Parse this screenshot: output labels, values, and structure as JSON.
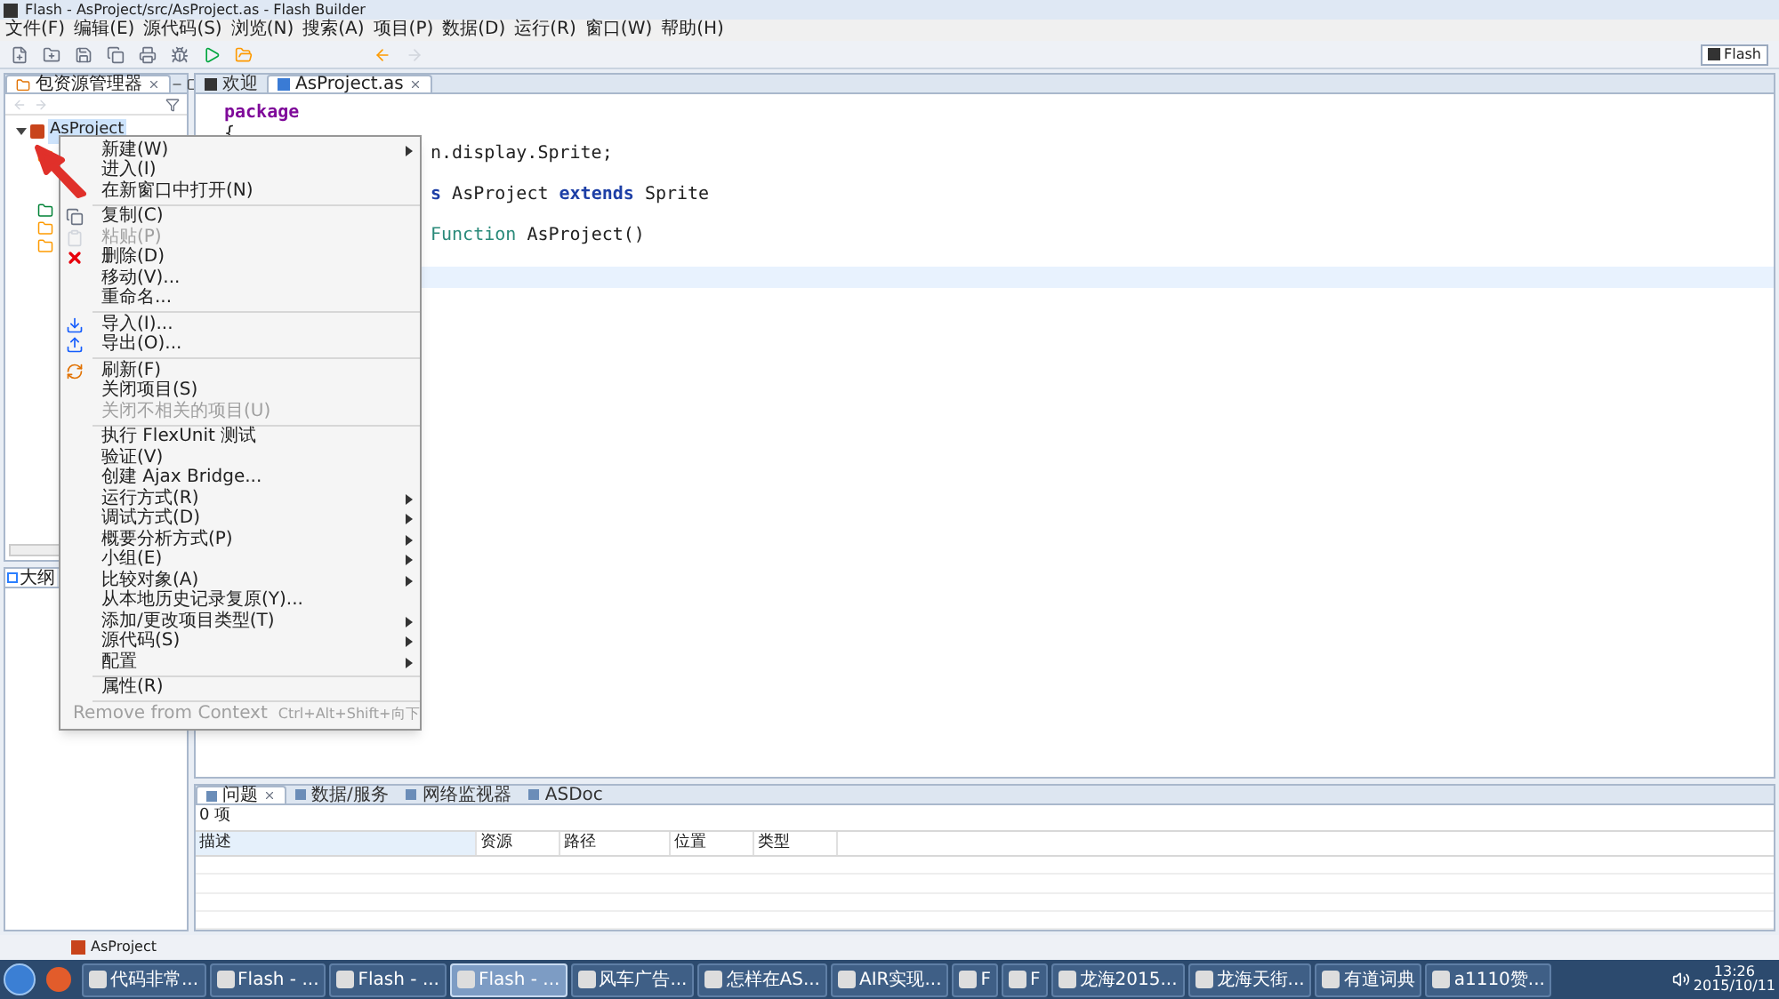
{
  "window": {
    "title": "Flash - AsProject/src/AsProject.as - Flash Builder"
  },
  "menu_bar": [
    "文件(F)",
    "编辑(E)",
    "源代码(S)",
    "浏览(N)",
    "搜索(A)",
    "项目(P)",
    "数据(D)",
    "运行(R)",
    "窗口(W)",
    "帮助(H)"
  ],
  "perspective": {
    "label": "Flash",
    "selected": true
  },
  "package_explorer": {
    "tab": "包资源管理器",
    "tree": [
      {
        "label": "AsProject",
        "selected": true,
        "expanded": true
      }
    ]
  },
  "outline": {
    "tab": "大纲"
  },
  "editor": {
    "tabs": [
      {
        "label": "欢迎",
        "selected": false
      },
      {
        "label": "AsProject.as",
        "selected": true
      }
    ],
    "lines": [
      {
        "kind": "full",
        "tokens": [
          {
            "text": "package",
            "kind": "keyword"
          }
        ]
      },
      {
        "kind": "full",
        "tokens": [
          {
            "text": "{",
            "kind": "plain"
          }
        ]
      },
      {
        "kind": "partial",
        "tokens": [
          {
            "text": "n.display.Sprite;",
            "kind": "plain"
          }
        ]
      },
      {
        "kind": "blank"
      },
      {
        "kind": "partial",
        "tokens": [
          {
            "text": "s",
            "kind": "declaration"
          },
          {
            "text": " AsProject ",
            "kind": "plain"
          },
          {
            "text": "extends",
            "kind": "declaration"
          },
          {
            "text": " Sprite",
            "kind": "plain"
          }
        ]
      },
      {
        "kind": "blank"
      },
      {
        "kind": "partial",
        "tokens": [
          {
            "text": "Function",
            "kind": "function"
          },
          {
            "text": " AsProject()",
            "kind": "plain"
          }
        ]
      },
      {
        "kind": "blank"
      },
      {
        "kind": "current"
      }
    ]
  },
  "context_menu": [
    {
      "kind": "item",
      "label": "新建(W)",
      "submenu": true,
      "disabled": false
    },
    {
      "kind": "item",
      "label": "进入(I)",
      "submenu": false,
      "disabled": false
    },
    {
      "kind": "item",
      "label": "在新窗口中打开(N)",
      "submenu": false,
      "disabled": false
    },
    {
      "kind": "separator"
    },
    {
      "kind": "item",
      "label": "复制(C)",
      "submenu": false,
      "disabled": false
    },
    {
      "kind": "item",
      "label": "粘贴(P)",
      "submenu": false,
      "disabled": true
    },
    {
      "kind": "item",
      "label": "删除(D)",
      "submenu": false,
      "disabled": false
    },
    {
      "kind": "item",
      "label": "移动(V)...",
      "submenu": false,
      "disabled": false
    },
    {
      "kind": "item",
      "label": "重命名...",
      "submenu": false,
      "disabled": false
    },
    {
      "kind": "separator"
    },
    {
      "kind": "item",
      "label": "导入(I)...",
      "submenu": false,
      "disabled": false
    },
    {
      "kind": "item",
      "label": "导出(O)...",
      "submenu": false,
      "disabled": false
    },
    {
      "kind": "separator"
    },
    {
      "kind": "item",
      "label": "刷新(F)",
      "submenu": false,
      "disabled": false
    },
    {
      "kind": "item",
      "label": "关闭项目(S)",
      "submenu": false,
      "disabled": false
    },
    {
      "kind": "item",
      "label": "关闭不相关的项目(U)",
      "submenu": false,
      "disabled": true
    },
    {
      "kind": "separator"
    },
    {
      "kind": "item",
      "label": "执行 FlexUnit 测试",
      "submenu": false,
      "disabled": false
    },
    {
      "kind": "item",
      "label": "验证(V)",
      "submenu": false,
      "disabled": false
    },
    {
      "kind": "item",
      "label": "创建 Ajax Bridge...",
      "submenu": false,
      "disabled": false
    },
    {
      "kind": "item",
      "label": "运行方式(R)",
      "submenu": true,
      "disabled": false
    },
    {
      "kind": "item",
      "label": "调试方式(D)",
      "submenu": true,
      "disabled": false
    },
    {
      "kind": "item",
      "label": "概要分析方式(P)",
      "submenu": true,
      "disabled": false
    },
    {
      "kind": "item",
      "label": "小组(E)",
      "submenu": true,
      "disabled": false
    },
    {
      "kind": "item",
      "label": "比较对象(A)",
      "submenu": true,
      "disabled": false
    },
    {
      "kind": "item",
      "label": "从本地历史记录复原(Y)...",
      "submenu": false,
      "disabled": false
    },
    {
      "kind": "item",
      "label": "添加/更改项目类型(T)",
      "submenu": true,
      "disabled": false
    },
    {
      "kind": "item",
      "label": "源代码(S)",
      "submenu": true,
      "disabled": false
    },
    {
      "kind": "item",
      "label": "配置",
      "submenu": true,
      "disabled": false
    },
    {
      "kind": "separator"
    },
    {
      "kind": "item",
      "label": "属性(R)",
      "submenu": false,
      "disabled": false
    },
    {
      "kind": "separator"
    },
    {
      "kind": "item",
      "label": "Remove from Context",
      "shortcut": "Ctrl+Alt+Shift+向下",
      "submenu": false,
      "disabled": true
    }
  ],
  "bottom_panel": {
    "tabs": [
      {
        "label": "问题",
        "selected": true
      },
      {
        "label": "数据/服务",
        "selected": false
      },
      {
        "label": "网络监视器",
        "selected": false
      },
      {
        "label": "ASDoc",
        "selected": false
      }
    ],
    "summary": "0 项",
    "columns": [
      "描述",
      "资源",
      "路径",
      "位置",
      "类型"
    ]
  },
  "status_bar": {
    "text": "AsProject"
  },
  "taskbar": {
    "items": [
      {
        "label": "代码非常...",
        "selected": false
      },
      {
        "label": "Flash - ...",
        "selected": false
      },
      {
        "label": "Flash - ...",
        "selected": false
      },
      {
        "label": "Flash - ...",
        "selected": true
      },
      {
        "label": "风车广告...",
        "selected": false
      },
      {
        "label": "怎样在AS...",
        "selected": false
      },
      {
        "label": "AIR实现...",
        "selected": false
      },
      {
        "label": "F",
        "selected": false
      },
      {
        "label": "F",
        "selected": false
      },
      {
        "label": "龙海2015...",
        "selected": false
      },
      {
        "label": "龙海天街...",
        "selected": false
      },
      {
        "label": "有道词典",
        "selected": false
      },
      {
        "label": "a1110赞...",
        "selected": false
      }
    ],
    "time": "13:26",
    "date": "2015/10/11"
  }
}
